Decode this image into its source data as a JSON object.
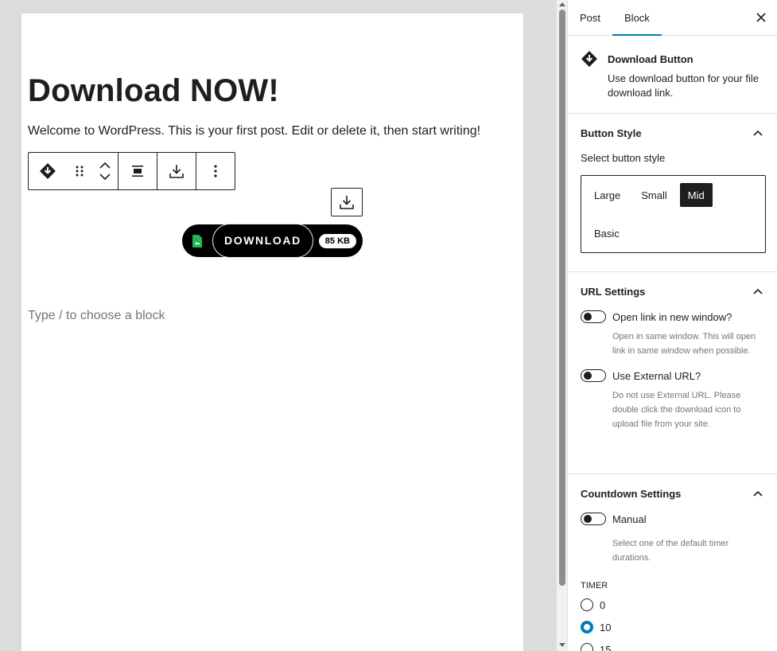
{
  "editor": {
    "title": "Download NOW!",
    "paragraph": "Welcome to WordPress. This is your first post. Edit or delete it, then start writing!",
    "placeholder": "Type / to choose a block",
    "download_button": {
      "label": "DOWNLOAD",
      "size": "85 KB"
    },
    "toolbar": {
      "icons": [
        "block-type-icon",
        "drag-handle-icon",
        "move-up-icon",
        "move-down-icon",
        "align-center-icon",
        "download-icon",
        "more-options-icon"
      ]
    }
  },
  "sidebar": {
    "tabs": [
      "Post",
      "Block"
    ],
    "active_tab": "Block",
    "block_card": {
      "title": "Download Button",
      "description": "Use download button for your file download link."
    },
    "button_style": {
      "heading": "Button Style",
      "label": "Select button style",
      "options": [
        "Large",
        "Small",
        "Mid",
        "Basic"
      ],
      "selected": "Mid"
    },
    "url_settings": {
      "heading": "URL Settings",
      "new_window": {
        "label": "Open link in new window?",
        "help": "Open in same window. This will open link in same window when possible."
      },
      "external_url": {
        "label": "Use External URL?",
        "help": "Do not use External URL. Please double click the download icon to upload file from your site."
      }
    },
    "countdown": {
      "heading": "Countdown Settings",
      "manual": {
        "label": "Manual",
        "help": "Select one of the default timer durations."
      },
      "timer_label": "TIMER",
      "timer_options": [
        "0",
        "10",
        "15"
      ],
      "selected": "10"
    }
  },
  "colors": {
    "accent": "#007cba",
    "text": "#1e1e1e",
    "muted": "#757575",
    "file_icon": "#1db954"
  }
}
